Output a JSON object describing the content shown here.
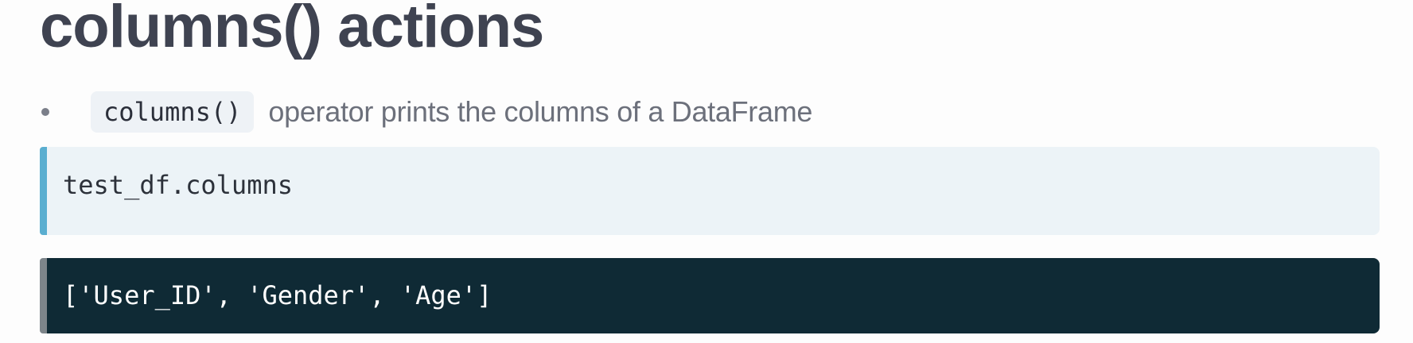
{
  "slide": {
    "title": "columns() actions",
    "bullet": {
      "code": "columns()",
      "text": "operator prints the columns of a DataFrame"
    },
    "code_block": {
      "code": "test_df.columns"
    },
    "output_block": {
      "output": "['User_ID', 'Gender', 'Age']"
    }
  },
  "colors": {
    "title": "#3f4351",
    "code_accent": "#5aaed0",
    "code_background": "#ecf3f7",
    "output_background": "#0f2a35",
    "output_accent": "#7d858a"
  }
}
